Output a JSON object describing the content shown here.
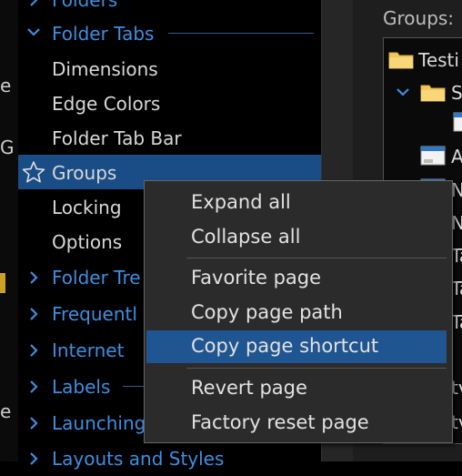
{
  "tree": {
    "items": [
      {
        "label": "Folders",
        "chevron": "right",
        "color": "blue"
      },
      {
        "label": "Folder Tabs",
        "chevron": "down",
        "color": "blue"
      },
      {
        "label": "Dimensions",
        "color": "white"
      },
      {
        "label": "Edge Colors",
        "color": "white"
      },
      {
        "label": "Folder Tab Bar",
        "color": "white"
      },
      {
        "label": "Groups",
        "color": "white",
        "selected": true
      },
      {
        "label": "Locking",
        "color": "white"
      },
      {
        "label": "Options",
        "color": "white"
      },
      {
        "label": "Folder Tre",
        "chevron": "right",
        "color": "blue"
      },
      {
        "label": "Frequentl",
        "chevron": "right",
        "color": "blue"
      },
      {
        "label": "Internet",
        "chevron": "right",
        "color": "blue"
      },
      {
        "label": "Labels",
        "chevron": "right",
        "color": "blue"
      },
      {
        "label": "Launching",
        "chevron": "right",
        "color": "blue"
      },
      {
        "label": "Layouts and Styles",
        "chevron": "right",
        "color": "blue"
      }
    ]
  },
  "left_edge": {
    "glyph1": "e",
    "glyph2": "G",
    "glyph3": "e"
  },
  "right_panel": {
    "title": "Groups:",
    "items": [
      "Testi",
      "S",
      "A",
      "N",
      "N",
      "Ta",
      "Ta",
      "Ta",
      "tv",
      "tv"
    ]
  },
  "context_menu": {
    "items": [
      {
        "label": "Expand all"
      },
      {
        "label": "Collapse all"
      },
      {
        "label": "Favorite page"
      },
      {
        "label": "Copy page path"
      },
      {
        "label": "Copy page shortcut",
        "highlighted": true
      },
      {
        "label": "Revert page"
      },
      {
        "label": "Factory reset page"
      }
    ]
  },
  "colors": {
    "accent_blue": "#3c8fe0",
    "selection": "#1a4d86",
    "menu_highlight": "#1f5590",
    "menu_bg": "#2b2b2b"
  }
}
